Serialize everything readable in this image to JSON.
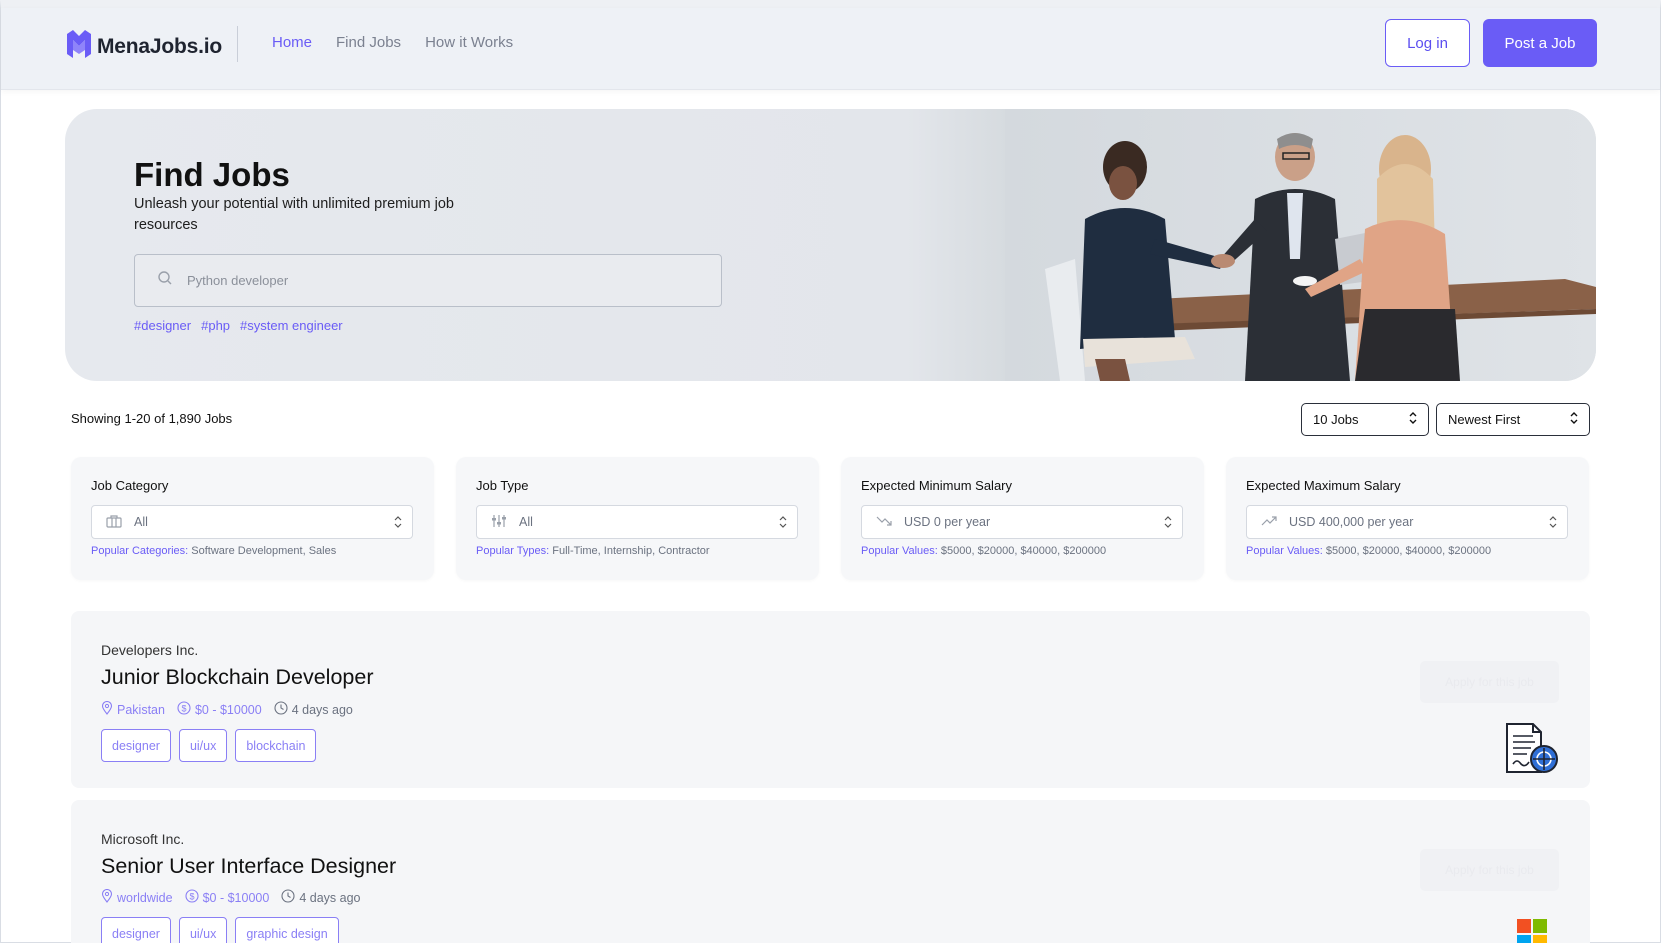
{
  "header": {
    "logo_text": "MenaJobs.io",
    "nav": [
      {
        "label": "Home"
      },
      {
        "label": "Find Jobs"
      },
      {
        "label": "How it Works"
      }
    ],
    "login_label": "Log in",
    "post_job_label": "Post a Job",
    "accent_color": "#6a5cf6"
  },
  "hero": {
    "title": "Find Jobs",
    "subtitle": "Unleash your potential with unlimited premium job resources",
    "search_placeholder": "Python developer",
    "tags": [
      "#designer",
      "#php",
      "#system engineer"
    ]
  },
  "results": {
    "summary": "Showing 1-20 of 1,890 Jobs",
    "per_page": "10 Jobs",
    "sort": "Newest First"
  },
  "filters": [
    {
      "label": "Job Category",
      "value": "All",
      "icon": "briefcase-icon",
      "popular_key": "Popular Categories:",
      "popular_values": "Software Development, Sales"
    },
    {
      "label": "Job Type",
      "value": "All",
      "icon": "sliders-icon",
      "popular_key": "Popular Types:",
      "popular_values": "Full-Time, Internship, Contractor"
    },
    {
      "label": "Expected Minimum Salary",
      "value": "USD 0 per year",
      "icon": "trending-down-icon",
      "popular_key": "Popular Values:",
      "popular_values": "$5000, $20000, $40000, $200000"
    },
    {
      "label": "Expected Maximum Salary",
      "value": "USD 400,000 per year",
      "icon": "trending-up-icon",
      "popular_key": "Popular Values:",
      "popular_values": "$5000, $20000, $40000, $200000"
    }
  ],
  "jobs": [
    {
      "company": "Developers Inc.",
      "title": "Junior Blockchain Developer",
      "location": "Pakistan",
      "salary": "$0 - $10000",
      "posted": "4 days ago",
      "tags": [
        "designer",
        "ui/ux",
        "blockchain"
      ],
      "apply_label": "Apply for this job",
      "logo_icon": "document-globe-icon"
    },
    {
      "company": "Microsoft Inc.",
      "title": "Senior User Interface Designer",
      "location": "worldwide",
      "salary": "$0 - $10000",
      "posted": "4 days ago",
      "tags": [
        "designer",
        "ui/ux",
        "graphic design"
      ],
      "apply_label": "Apply for this job",
      "logo_icon": "microsoft-logo-icon"
    }
  ]
}
